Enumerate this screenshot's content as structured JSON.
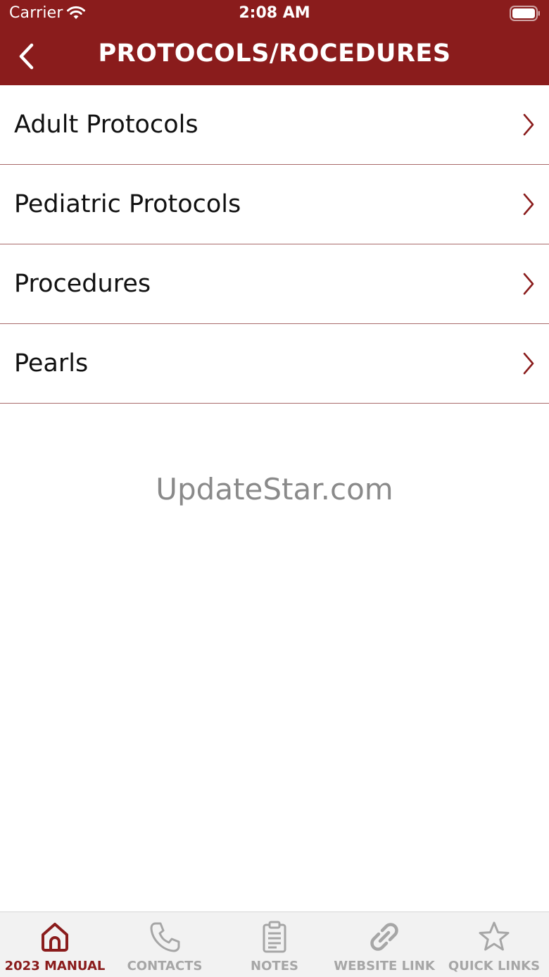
{
  "status_bar": {
    "carrier": "Carrier",
    "time": "2:08 AM"
  },
  "nav": {
    "title": "PROTOCOLS/ROCEDURES",
    "back_icon": "chevron-left-icon"
  },
  "menu": {
    "items": [
      {
        "label": "Adult Protocols"
      },
      {
        "label": "Pediatric Protocols"
      },
      {
        "label": "Procedures"
      },
      {
        "label": "Pearls"
      }
    ]
  },
  "watermark": "UpdateStar.com",
  "tab_bar": {
    "tabs": [
      {
        "label": "2023 MANUAL",
        "icon": "home-icon",
        "active": true
      },
      {
        "label": "CONTACTS",
        "icon": "phone-icon",
        "active": false
      },
      {
        "label": "NOTES",
        "icon": "clipboard-icon",
        "active": false
      },
      {
        "label": "WEBSITE LINK",
        "icon": "link-icon",
        "active": false
      },
      {
        "label": "QUICK LINKS",
        "icon": "star-icon",
        "active": false
      }
    ]
  },
  "colors": {
    "brand": "#8a1c1c",
    "inactive_tab": "#a6a6a6",
    "divider": "#a86a6a"
  }
}
